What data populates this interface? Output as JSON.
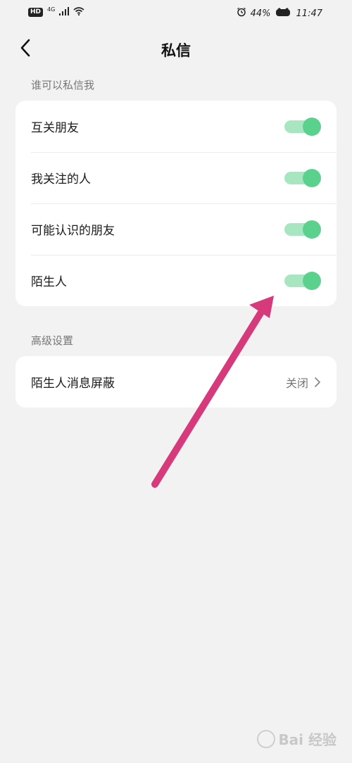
{
  "status_bar": {
    "hd": "HD",
    "network": "4G",
    "battery": "44%",
    "time": "11:47"
  },
  "header": {
    "title": "私信"
  },
  "who_can_message": {
    "section_title": "谁可以私信我",
    "items": [
      {
        "label": "互关朋友",
        "enabled": true
      },
      {
        "label": "我关注的人",
        "enabled": true
      },
      {
        "label": "可能认识的朋友",
        "enabled": true
      },
      {
        "label": "陌生人",
        "enabled": true
      }
    ]
  },
  "advanced": {
    "section_title": "高级设置",
    "items": [
      {
        "label": "陌生人消息屏蔽",
        "value": "关闭"
      }
    ]
  },
  "watermark": {
    "text": "Bai 经验"
  },
  "colors": {
    "toggle_on_track": "#a8e6c2",
    "toggle_on_knob": "#5ad28e",
    "annotation_arrow": "#d63a7a",
    "background": "#f2f2f2"
  }
}
